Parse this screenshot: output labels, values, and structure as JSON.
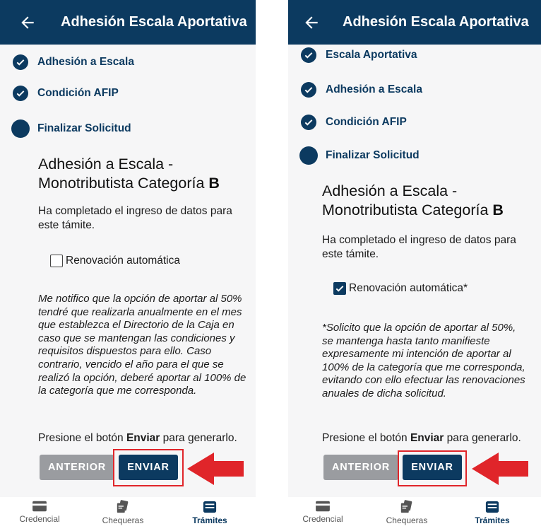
{
  "app": {
    "title": "Adhesión Escala Aportativa",
    "colors": {
      "primary": "#0c3a60",
      "secondary_button": "#9a9ca0",
      "highlight": "#e0252a",
      "background": "#f6f6f7"
    }
  },
  "left": {
    "steps": [
      {
        "label": "Adhesión a Escala",
        "status": "done"
      },
      {
        "label": "Condición AFIP",
        "status": "done"
      },
      {
        "label": "Finalizar Solicitud",
        "status": "current"
      }
    ],
    "heading_line1": "Adhesión a Escala -",
    "heading_line2": "Monotributista Categoría",
    "heading_category": "B",
    "completed_line1": "Ha completado el ingreso de datos para",
    "completed_line2": "este támite.",
    "renewal_label": "Renovación automática",
    "renewal_checked": false,
    "note_lines": [
      "Me notifico que la opción de aportar al 50%",
      "tendré que realizarla anualmente en el mes",
      "que establezca el Directorio de la Caja en",
      "caso que se mantengan las condiciones y",
      "requisitos dispuestos para ello. Caso",
      "contrario, vencido el año para el que se",
      "realizó la opción, deberé aportar al 100% de",
      "la categoría que me corresponda."
    ],
    "press_prefix": "Presione el botón",
    "press_bold": "Enviar",
    "press_suffix": "para generarlo.",
    "prev_button": "ANTERIOR",
    "send_button": "ENVIAR"
  },
  "right": {
    "steps": [
      {
        "label": "Escala Aportativa",
        "status": "done"
      },
      {
        "label": "Adhesión a Escala",
        "status": "done"
      },
      {
        "label": "Condición AFIP",
        "status": "done"
      },
      {
        "label": "Finalizar Solicitud",
        "status": "current"
      }
    ],
    "heading_line1": "Adhesión a Escala -",
    "heading_line2": "Monotributista Categoría",
    "heading_category": "B",
    "completed_line1": "Ha completado el ingreso de datos para",
    "completed_line2": "este támite.",
    "renewal_label": "Renovación automática*",
    "renewal_checked": true,
    "note_lines": [
      "*Solicito que la opción de aportar al 50%,",
      "se mantenga hasta tanto manifieste",
      "expresamente mi intención de aportar al",
      "100% de la categoría que me corresponda,",
      "evitando con ello efectuar las renovaciones",
      "anuales de dicha solicitud."
    ],
    "press_prefix": "Presione el botón",
    "press_bold": "Enviar",
    "press_suffix": "para generarlo.",
    "prev_button": "ANTERIOR",
    "send_button": "ENVIAR"
  },
  "nav": {
    "items": [
      {
        "label": "Credencial",
        "icon": "credential-card-icon",
        "active": false
      },
      {
        "label": "Chequeras",
        "icon": "checkbook-icon",
        "active": false
      },
      {
        "label": "Trámites",
        "icon": "tramites-tray-icon",
        "active": true
      }
    ]
  }
}
